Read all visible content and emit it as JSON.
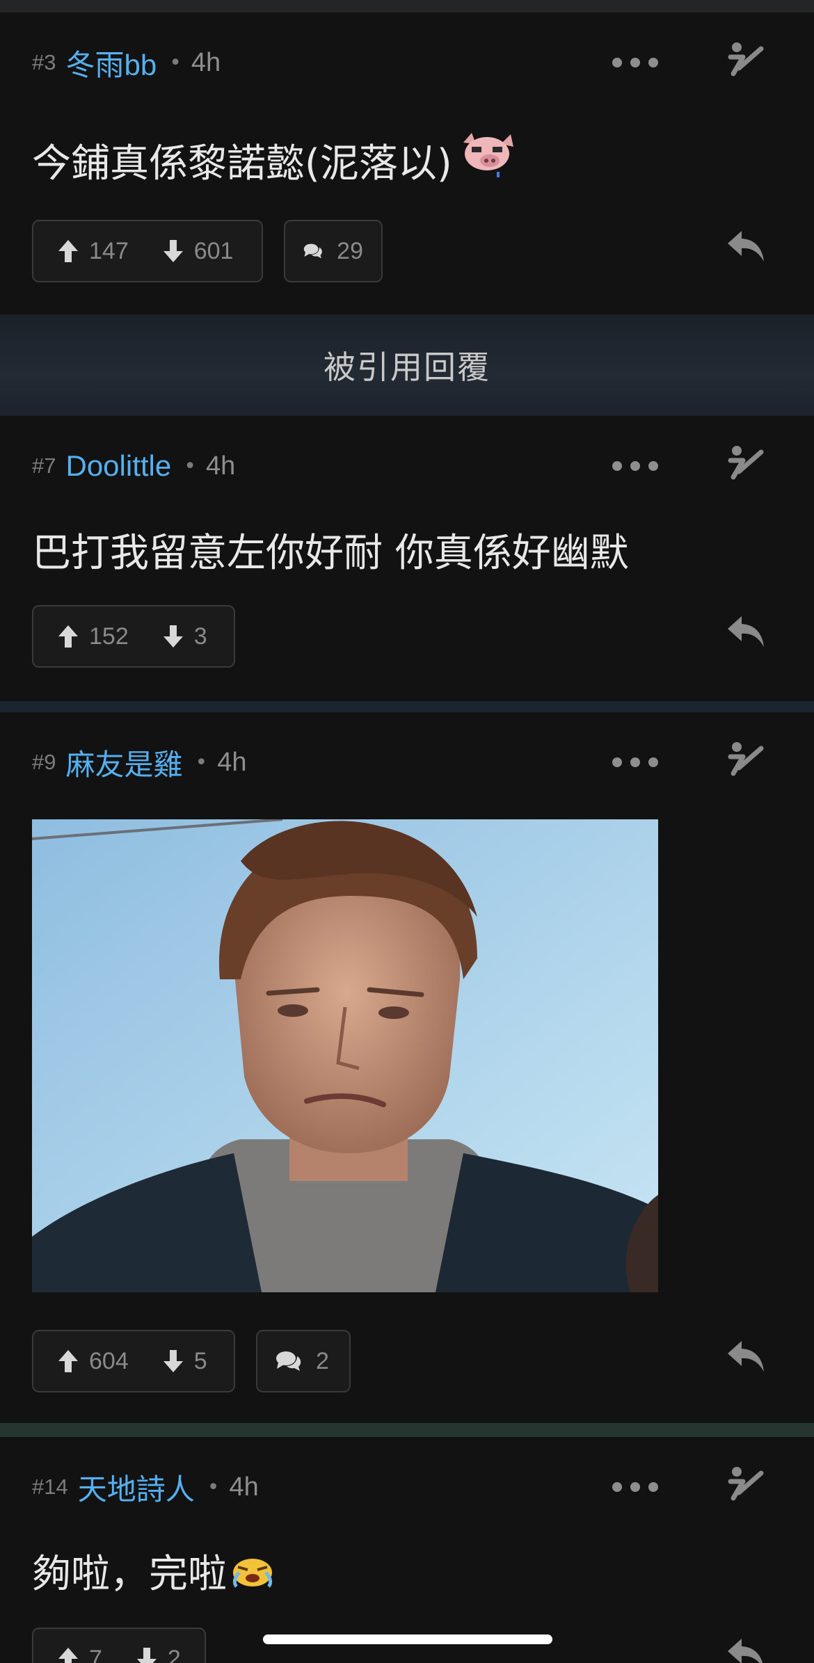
{
  "quoted_label": "被引用回覆",
  "posts": [
    {
      "floor": "#3",
      "user": "冬雨bb",
      "sep": "•",
      "time": "4h",
      "text": "今鋪真係黎諾懿(泥落以)",
      "sticker": "pig-face-icon",
      "upvotes": "147",
      "downvotes": "601",
      "comments": "29"
    },
    {
      "floor": "#7",
      "user": "Doolittle",
      "sep": "•",
      "time": "4h",
      "text": "巴打我留意左你好耐 你真係好幽默",
      "upvotes": "152",
      "downvotes": "3"
    },
    {
      "floor": "#9",
      "user": "麻友是雞",
      "sep": "•",
      "time": "4h",
      "media": "gif-image",
      "upvotes": "604",
      "downvotes": "5",
      "comments": "2"
    },
    {
      "floor": "#14",
      "user": "天地詩人",
      "sep": "•",
      "time": "4h",
      "text": "夠啦，完啦",
      "sticker": "crying-face-icon",
      "upvotes": "7",
      "downvotes": "2"
    }
  ],
  "colors": {
    "background": "#121212",
    "username": "#56b0f0",
    "muted": "#8e8e8e",
    "text": "#e8e8e8"
  }
}
